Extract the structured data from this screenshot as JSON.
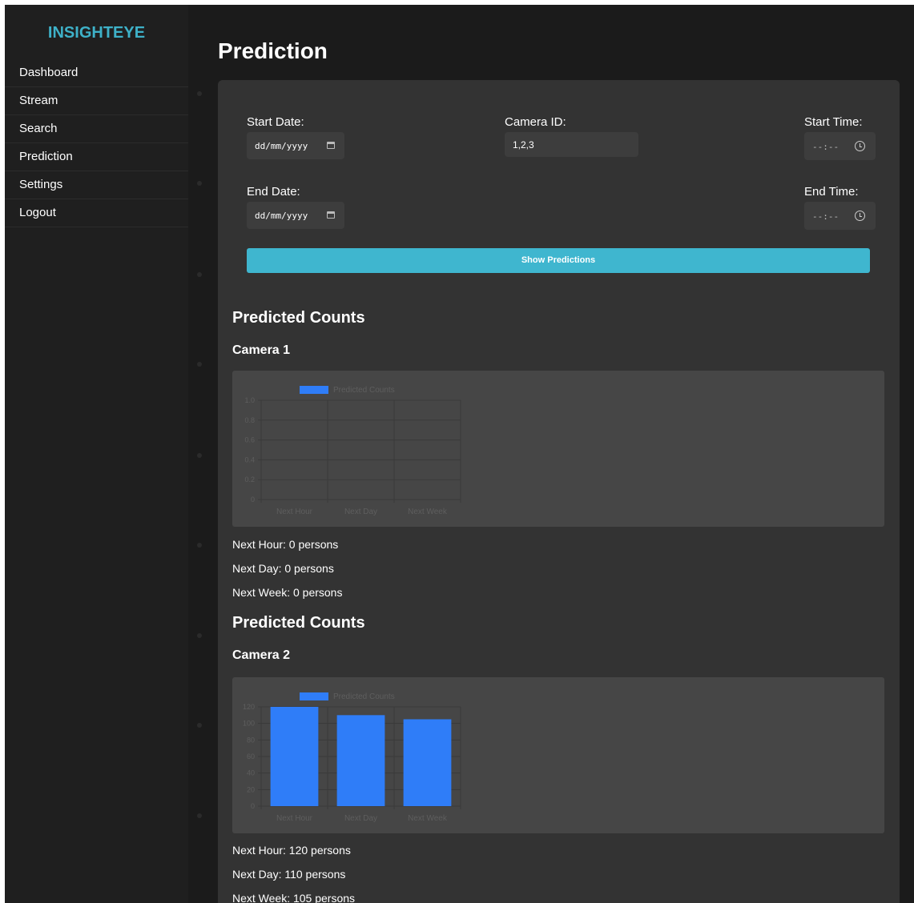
{
  "app": {
    "brand": "INSIGHTEYE"
  },
  "sidebar": {
    "items": [
      {
        "label": "Dashboard"
      },
      {
        "label": "Stream"
      },
      {
        "label": "Search"
      },
      {
        "label": "Prediction"
      },
      {
        "label": "Settings"
      },
      {
        "label": "Logout"
      }
    ]
  },
  "page": {
    "title": "Prediction"
  },
  "form": {
    "start_date_label": "Start Date:",
    "start_date_value": "dd/mm/yyyy",
    "end_date_label": "End Date:",
    "end_date_value": "dd/mm/yyyy",
    "camera_id_label": "Camera ID:",
    "camera_id_value": "1,2,3",
    "start_time_label": "Start Time:",
    "start_time_value": "--:--",
    "end_time_label": "End Time:",
    "end_time_value": "--:--",
    "submit_label": "Show Predictions"
  },
  "results": [
    {
      "section_title": "Predicted Counts",
      "camera_title": "Camera 1",
      "stats": [
        "Next Hour: 0 persons",
        "Next Day: 0 persons",
        "Next Week: 0 persons"
      ]
    },
    {
      "section_title": "Predicted Counts",
      "camera_title": "Camera 2",
      "stats": [
        "Next Hour: 120 persons",
        "Next Day: 110 persons",
        "Next Week: 105 persons"
      ]
    }
  ],
  "colors": {
    "accent": "#3eb1c8",
    "bar": "#2f7df8",
    "background": "#1b1b1b",
    "panel": "#333333"
  },
  "chart_data": [
    {
      "type": "bar",
      "categories": [
        "Next Hour",
        "Next Day",
        "Next Week"
      ],
      "series": [
        {
          "name": "Predicted Counts",
          "values": [
            0,
            0,
            0
          ]
        }
      ],
      "yticks": [
        "0",
        "0.2",
        "0.4",
        "0.6",
        "0.8",
        "1.0"
      ],
      "ylim": [
        0,
        1
      ],
      "grid": true,
      "legend": "top"
    },
    {
      "type": "bar",
      "categories": [
        "Next Hour",
        "Next Day",
        "Next Week"
      ],
      "series": [
        {
          "name": "Predicted Counts",
          "values": [
            120,
            110,
            105
          ]
        }
      ],
      "yticks": [
        "0",
        "20",
        "40",
        "60",
        "80",
        "100",
        "120"
      ],
      "ylim": [
        0,
        120
      ],
      "grid": true,
      "legend": "top"
    }
  ]
}
